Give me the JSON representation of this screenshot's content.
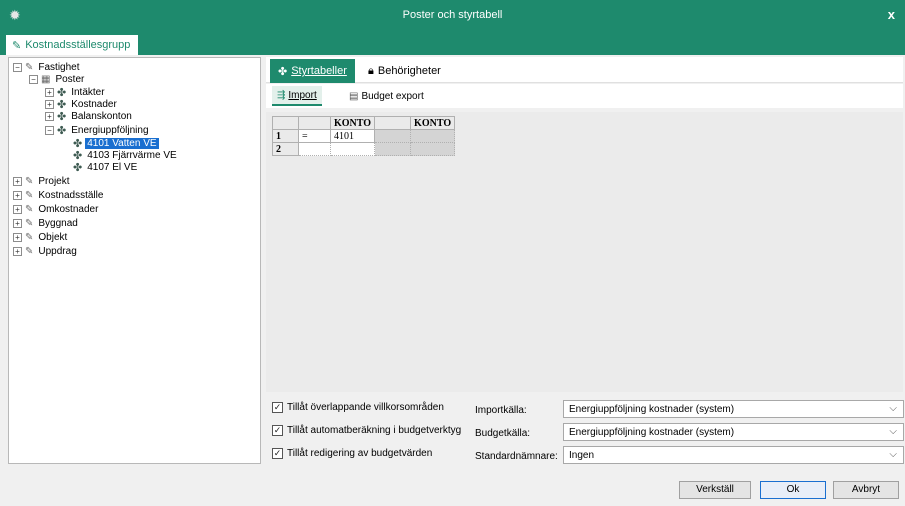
{
  "window": {
    "title": "Poster och styrtabell",
    "close": "x"
  },
  "main_tab": {
    "label": "Kostnadsställesgrupp"
  },
  "tree": [
    {
      "label": "Fastighet",
      "toggle": "−",
      "icon": "pencil-icon"
    },
    {
      "label": "Poster",
      "toggle": "−",
      "icon": "poster-icon"
    },
    {
      "label": "Intäkter",
      "toggle": "+",
      "icon": "puzzle-icon"
    },
    {
      "label": "Kostnader",
      "toggle": "+",
      "icon": "puzzle-icon"
    },
    {
      "label": "Balanskonton",
      "toggle": "+",
      "icon": "puzzle-icon"
    },
    {
      "label": "Energiuppföljning",
      "toggle": "−",
      "icon": "puzzle-icon"
    },
    {
      "label": "4101 Vatten VE",
      "toggle": "",
      "icon": "puzzle-icon",
      "selected": true
    },
    {
      "label": "4103 Fjärrvärme VE",
      "toggle": "",
      "icon": "puzzle-icon"
    },
    {
      "label": "4107 El VE",
      "toggle": "",
      "icon": "puzzle-icon"
    },
    {
      "label": "Projekt",
      "toggle": "+",
      "icon": "pencil-icon"
    },
    {
      "label": "Kostnadsställe",
      "toggle": "+",
      "icon": "pencil-icon"
    },
    {
      "label": "Omkostnader",
      "toggle": "+",
      "icon": "pencil-icon"
    },
    {
      "label": "Byggnad",
      "toggle": "+",
      "icon": "pencil-icon"
    },
    {
      "label": "Objekt",
      "toggle": "+",
      "icon": "pencil-icon"
    },
    {
      "label": "Uppdrag",
      "toggle": "+",
      "icon": "pencil-icon"
    }
  ],
  "sub_tabs": {
    "styrtabeller": "Styrtabeller",
    "behorigheter": "Behörigheter"
  },
  "toolbar": {
    "import": "Import",
    "budget_export": "Budget export"
  },
  "table": {
    "headers": [
      "KONTO",
      "KONTO"
    ],
    "rows": [
      {
        "num": "1",
        "op": "=",
        "konto1": "4101"
      },
      {
        "num": "2",
        "op": "",
        "konto1": ""
      }
    ]
  },
  "options": {
    "overlap": "Tillåt överlappande villkorsområden",
    "auto_calc": "Tillåt automatberäkning i budgetverktyg",
    "edit_budget": "Tillåt redigering av budgetvärden",
    "check": "✓"
  },
  "fields": {
    "import_label": "Importkälla:",
    "import_value": "Energiuppföljning kostnader (system)",
    "budget_label": "Budgetkälla:",
    "budget_value": "Energiuppföljning kostnader (system)",
    "denominator_label": "Standardnämnare:",
    "denominator_value": "Ingen"
  },
  "buttons": {
    "apply": "Verkställ",
    "ok": "Ok",
    "cancel": "Avbryt"
  },
  "colors": {
    "accent": "#1e8a6d",
    "selection": "#1a6fd0"
  }
}
